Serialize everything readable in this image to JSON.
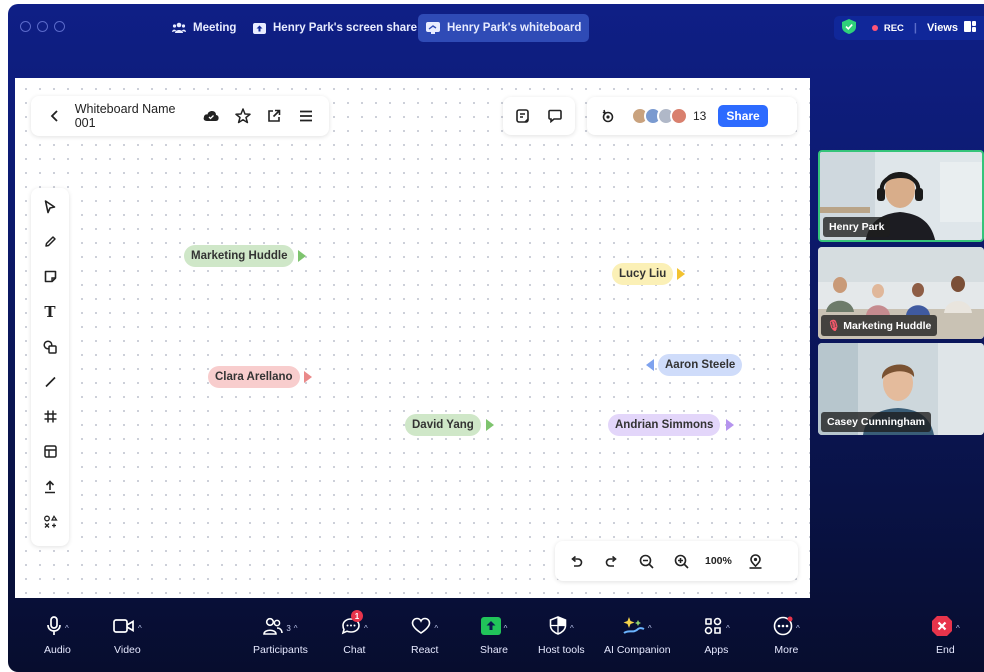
{
  "titlebar": {
    "tabs": [
      {
        "label": "Meeting",
        "active": false,
        "icon": "meeting-people-icon"
      },
      {
        "label": "Henry Park's screen share",
        "active": false,
        "icon": "screen-share-icon"
      },
      {
        "label": "Henry Park's whiteboard",
        "active": true,
        "icon": "whiteboard-icon"
      }
    ],
    "rec_label": "REC",
    "views_label": "Views"
  },
  "whiteboard": {
    "name": "Whiteboard Name 001",
    "participant_count": "13",
    "share_label": "Share",
    "zoom_level": "100%",
    "tools": [
      "select-icon",
      "pen-icon",
      "sticky-note-icon",
      "text-icon",
      "shapes-icon",
      "line-icon",
      "frame-icon",
      "template-icon",
      "upload-icon",
      "more-tools-icon"
    ],
    "cursors": [
      {
        "name": "Marketing Huddle",
        "color": "#cfe7c8",
        "arrow": "#7ec46e"
      },
      {
        "name": "Lucy Liu",
        "color": "#fbf0b6",
        "arrow": "#f2c230"
      },
      {
        "name": "Aaron Steele",
        "color": "#cfdcfa",
        "arrow": "#7ea2ee"
      },
      {
        "name": "Clara Arellano",
        "color": "#f8cdcd",
        "arrow": "#ea8a8a"
      },
      {
        "name": "David Yang",
        "color": "#cfe7c8",
        "arrow": "#7ec46e"
      },
      {
        "name": "Andrian Simmons",
        "color": "#e3d6fa",
        "arrow": "#b594ee"
      }
    ]
  },
  "videos": [
    {
      "name": "Henry Park",
      "active": true
    },
    {
      "name": "Marketing Huddle",
      "muted": true
    },
    {
      "name": "Casey Cunningham"
    }
  ],
  "controls": [
    {
      "label": "Audio",
      "icon": "microphone-icon"
    },
    {
      "label": "Video",
      "icon": "video-camera-icon"
    },
    {
      "label": "Participants",
      "icon": "participants-icon",
      "count": "3"
    },
    {
      "label": "Chat",
      "icon": "chat-icon",
      "badge": "1"
    },
    {
      "label": "React",
      "icon": "heart-icon"
    },
    {
      "label": "Share",
      "icon": "share-screen-icon"
    },
    {
      "label": "Host tools",
      "icon": "shield-icon"
    },
    {
      "label": "AI Companion",
      "icon": "ai-companion-icon"
    },
    {
      "label": "Apps",
      "icon": "apps-icon"
    },
    {
      "label": "More",
      "icon": "more-icon"
    },
    {
      "label": "End",
      "icon": "end-icon"
    }
  ]
}
